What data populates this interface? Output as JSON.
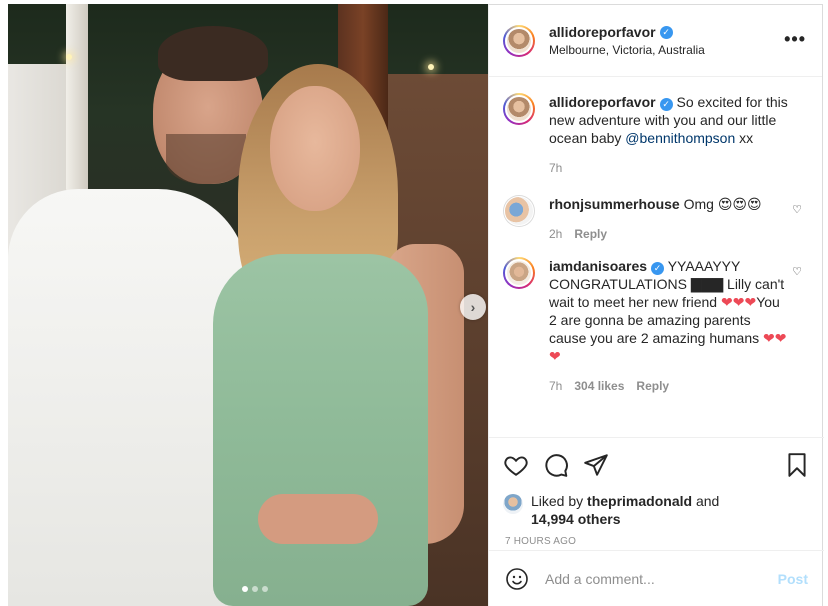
{
  "post": {
    "username": "allidoreporfavor",
    "location": "Melbourne, Victoria, Australia",
    "more_label": "•••",
    "caption": {
      "username": "allidoreporfavor",
      "text_before": "So excited for this new adventure with you and our little ocean baby ",
      "mention": "@bennithompson",
      "text_after": " xx",
      "time": "7h"
    },
    "comments": [
      {
        "username": "rhonjsummerhouse",
        "text": "Omg ",
        "emojis": "😍😍😍",
        "time": "2h",
        "likes": "",
        "reply_label": "Reply"
      },
      {
        "username": "iamdanisoares",
        "text_part1": "YYAAAYYY CONGRATULATIONS ",
        "blocks": "▇▇▇",
        "text_part2": " Lilly can't wait to meet her new friend ",
        "hearts1": "❤❤❤",
        "text_part3": "You 2 are gonna be amazing parents cause you are 2 amazing humans ",
        "hearts2": "❤❤❤",
        "time": "7h",
        "likes": "304 likes",
        "reply_label": "Reply"
      }
    ],
    "liked_by_prefix": "Liked by ",
    "liked_by_user": "theprimadonald",
    "liked_by_mid": " and",
    "liked_by_count": "14,994 others",
    "timestamp": "7 HOURS AGO",
    "add_comment_placeholder": "Add a comment...",
    "post_label": "Post"
  },
  "carousel": {
    "next_label": "›",
    "slides": 3,
    "active_slide": 1
  }
}
